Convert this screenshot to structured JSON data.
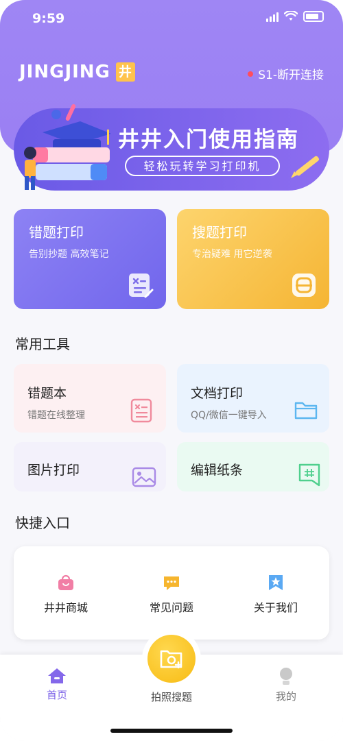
{
  "status_bar": {
    "time": "9:59"
  },
  "header": {
    "logo_text": "JINGJING",
    "logo_badge": "井",
    "connection": "S1-断开连接"
  },
  "banner": {
    "title": "井井入门使用指南",
    "subtitle": "轻松玩转学习打印机"
  },
  "feature_cards": [
    {
      "title": "错题打印",
      "subtitle": "告别抄题 高效笔记"
    },
    {
      "title": "搜题打印",
      "subtitle": "专治疑难 用它逆袭"
    }
  ],
  "tools_section": {
    "title": "常用工具",
    "items": [
      {
        "title": "错题本",
        "subtitle": "错题在线整理"
      },
      {
        "title": "文档打印",
        "subtitle": "QQ/微信一键导入"
      },
      {
        "title": "图片打印",
        "subtitle": ""
      },
      {
        "title": "编辑纸条",
        "subtitle": ""
      }
    ]
  },
  "quick_section": {
    "title": "快捷入口",
    "items": [
      {
        "label": "井井商城",
        "icon": "shopping-bag-icon"
      },
      {
        "label": "常见问题",
        "icon": "chat-bubble-icon"
      },
      {
        "label": "关于我们",
        "icon": "bookmark-star-icon"
      }
    ]
  },
  "tabbar": {
    "home": "首页",
    "camera": "拍照搜题",
    "mine": "我的"
  },
  "colors": {
    "primary": "#9a7ff3",
    "accent_yellow": "#f7bb13",
    "status_red": "#ff4d5e"
  }
}
